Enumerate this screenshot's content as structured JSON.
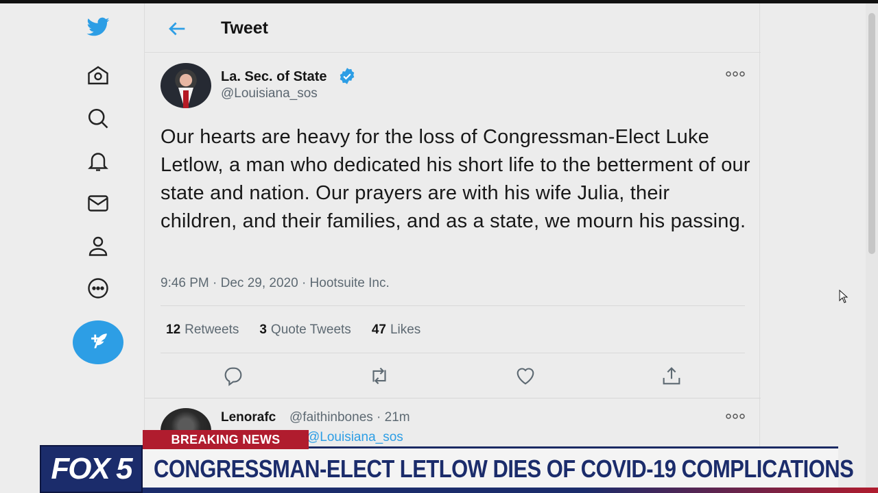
{
  "header": {
    "title": "Tweet"
  },
  "tweet": {
    "display_name": "La. Sec. of State",
    "handle": "@Louisiana_sos",
    "text": "Our hearts are heavy for the loss of Congressman-Elect Luke Letlow, a man who dedicated his short life to the betterment of our state and nation. Our prayers are with his wife Julia, their children, and their families, and as a state, we mourn his passing.",
    "timestamp": "9:46 PM · Dec 29, 2020 · Hootsuite Inc.",
    "stats": {
      "retweets_count": "12",
      "retweets_label": "Retweets",
      "quotes_count": "3",
      "quotes_label": "Quote Tweets",
      "likes_count": "47",
      "likes_label": "Likes"
    }
  },
  "reply": {
    "display_name": "Lenorafc",
    "handle_time": "@faithinbones · 21m",
    "replying_to": "@Louisiana_sos"
  },
  "broadcast": {
    "tag": "BREAKING NEWS",
    "logo": "FOX 5",
    "headline": "CONGRESSMAN-ELECT LETLOW DIES OF COVID-19 COMPLICATIONS"
  },
  "icons": {
    "nav": [
      "twitter-bird-icon",
      "home-icon",
      "search-icon",
      "bell-icon",
      "mail-icon",
      "profile-icon",
      "more-circle-icon",
      "compose-icon"
    ],
    "actions": [
      "reply-icon",
      "retweet-icon",
      "like-icon",
      "share-icon"
    ]
  },
  "colors": {
    "accent": "#2d9ee5",
    "breaking": "#b01c2e",
    "fox_navy": "#1b2c6b"
  }
}
